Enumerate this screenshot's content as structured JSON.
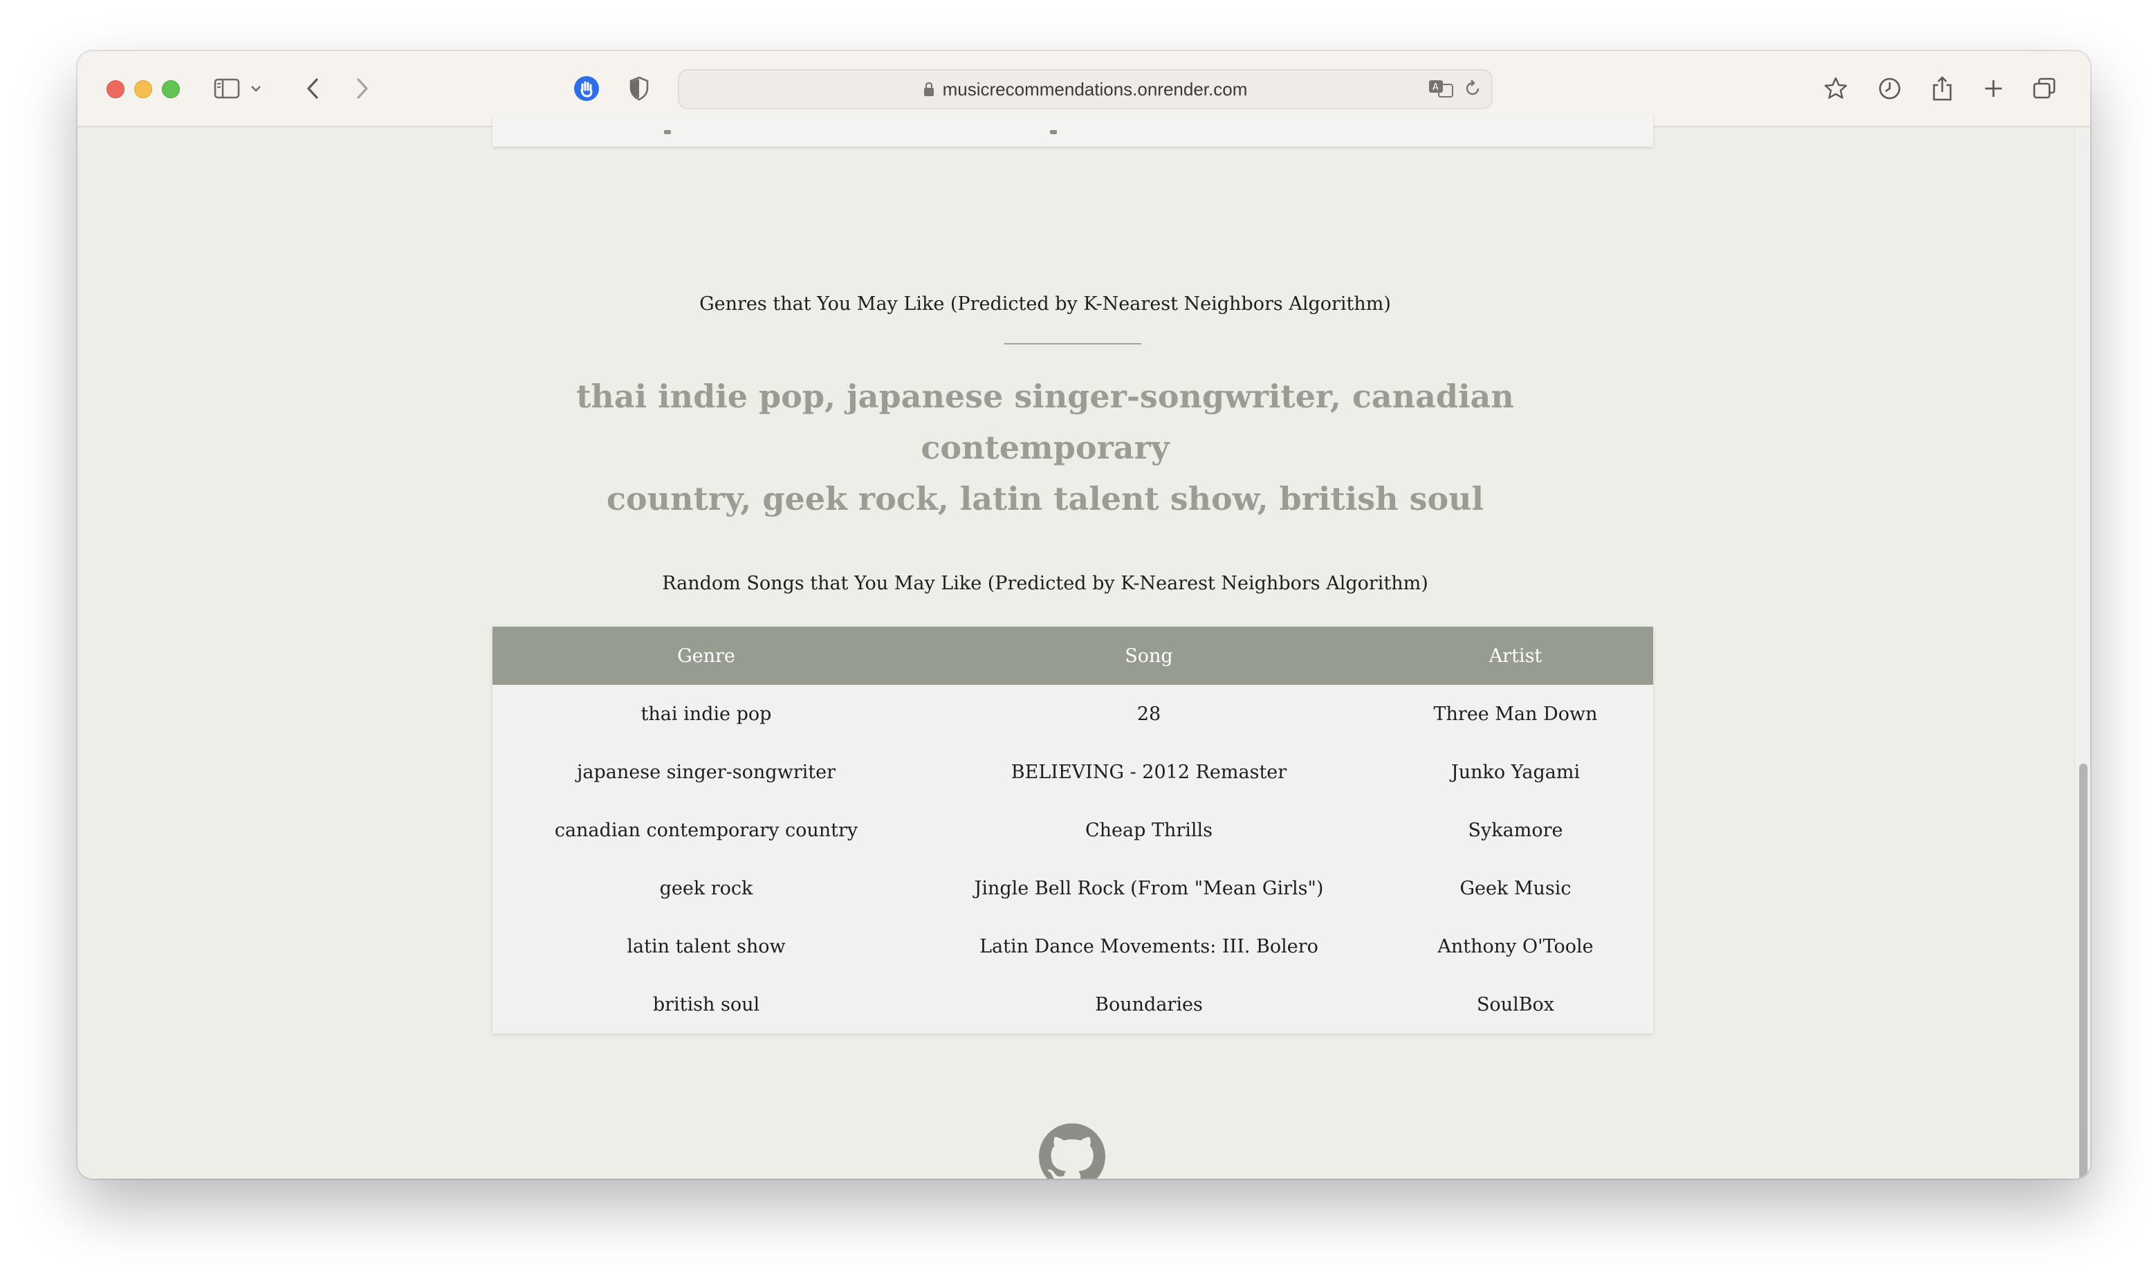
{
  "browser": {
    "url": "musicrecommendations.onrender.com",
    "icons": [
      "sidebar-icon",
      "chevron-down-icon",
      "back-icon",
      "forward-icon",
      "hand-icon",
      "shield-icon",
      "lock-icon",
      "translate-icon",
      "reload-icon",
      "star-icon",
      "history-icon",
      "share-icon",
      "plus-icon",
      "tabs-icon"
    ]
  },
  "genres_section": {
    "heading": "Genres that You May Like (Predicted by K-Nearest Neighbors Algorithm)",
    "genres_line_1": "thai indie pop, japanese singer-songwriter, canadian contemporary",
    "genres_line_2": "country, geek rock, latin talent show, british soul"
  },
  "songs_section": {
    "heading": "Random Songs that You May Like (Predicted by K-Nearest Neighbors Algorithm)",
    "columns": [
      "Genre",
      "Song",
      "Artist"
    ],
    "rows": [
      {
        "genre": "thai indie pop",
        "song": "28",
        "artist": "Three Man Down"
      },
      {
        "genre": "japanese singer-songwriter",
        "song": "BELIEVING - 2012 Remaster",
        "artist": "Junko Yagami"
      },
      {
        "genre": "canadian contemporary country",
        "song": "Cheap Thrills",
        "artist": "Sykamore"
      },
      {
        "genre": "geek rock",
        "song": "Jingle Bell Rock (From \"Mean Girls\")",
        "artist": "Geek Music"
      },
      {
        "genre": "latin talent show",
        "song": "Latin Dance Movements: III. Bolero",
        "artist": "Anthony O'Toole"
      },
      {
        "genre": "british soul",
        "song": "Boundaries",
        "artist": "SoulBox"
      }
    ]
  },
  "footer": {
    "icon": "github-icon"
  },
  "colors": {
    "page_background": "#eeeee9",
    "table_header": "#979c91",
    "genres_text": "#9b9d95",
    "table_body": "#f1f1f0"
  }
}
